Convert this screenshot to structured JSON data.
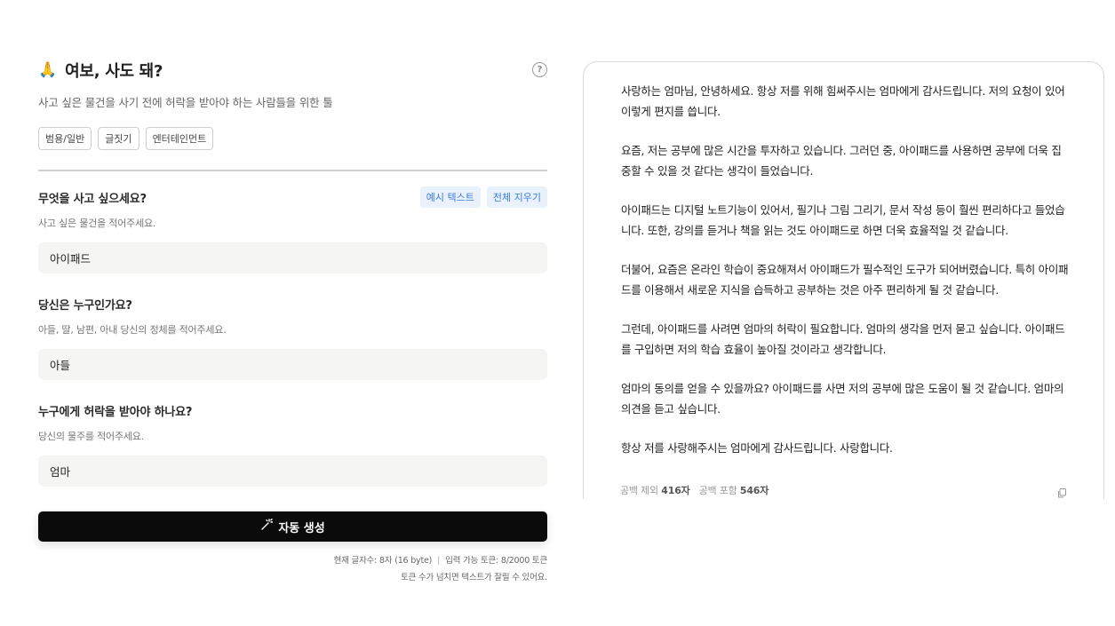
{
  "app": {
    "emoji": "🙏",
    "title": "여보, 사도 돼?",
    "subtitle": "사고 싶은 물건을 사기 전에 허락을 받아야 하는 사람들을 위한 툴",
    "help_glyph": "?",
    "tags": [
      "범용/일반",
      "글짓기",
      "엔터테인먼트"
    ]
  },
  "form": {
    "sample_button": "예시 텍스트",
    "clear_button": "전체 지우기",
    "fields": [
      {
        "label": "무엇을 사고 싶으세요?",
        "hint": "사고 싶은 물건을 적어주세요.",
        "value": "아이패드"
      },
      {
        "label": "당신은 누구인가요?",
        "hint": "아들, 딸, 남편, 아내 당신의 정체를 적어주세요.",
        "value": "아들"
      },
      {
        "label": "누구에게 허락을 받아야 하나요?",
        "hint": "당신의 물주를 적어주세요.",
        "value": "엄마"
      }
    ],
    "generate_button": "자동 생성",
    "char_count": "현재 글자수: 8자 (16 byte)",
    "token_info": "입력 가능 토큰: 8/2000 토큰",
    "token_warning": "토큰 수가 넘치면 텍스트가 잘릴 수 있어요."
  },
  "output": {
    "paragraphs": [
      "사랑하는 엄마님, 안녕하세요. 항상 저를 위해 힘써주시는 엄마에게 감사드립니다. 저의 요청이 있어 이렇게 편지를 씁니다.",
      "요즘, 저는 공부에 많은 시간을 투자하고 있습니다. 그러던 중, 아이패드를 사용하면 공부에 더욱 집중할 수 있을 것 같다는 생각이 들었습니다.",
      "아이패드는 디지털 노트기능이 있어서, 필기나 그림 그리기, 문서 작성 등이 훨씬 편리하다고 들었습니다. 또한, 강의를 듣거나 책을 읽는 것도 아이패드로 하면 더욱 효율적일 것 같습니다.",
      "더불어, 요즘은 온라인 학습이 중요해져서 아이패드가 필수적인 도구가 되어버렸습니다. 특히 아이패드를 이용해서 새로운 지식을 습득하고 공부하는 것은 아주 편리하게 될 것 같습니다.",
      "그런데, 아이패드를 사려면 엄마의 허락이 필요합니다. 엄마의 생각을 먼저 묻고 싶습니다. 아이패드를 구입하면 저의 학습 효율이 높아질 것이라고 생각합니다.",
      "엄마의 동의를 얻을 수 있을까요? 아이패드를 사면 저의 공부에 많은 도움이 될 것 같습니다. 엄마의 의견을 듣고 싶습니다.",
      "항상 저를 사랑해주시는 엄마에게 감사드립니다. 사랑합니다."
    ],
    "count_no_space_label": "공백 제외",
    "count_no_space_value": "416자",
    "count_with_space_label": "공백 포함",
    "count_with_space_value": "546자"
  }
}
